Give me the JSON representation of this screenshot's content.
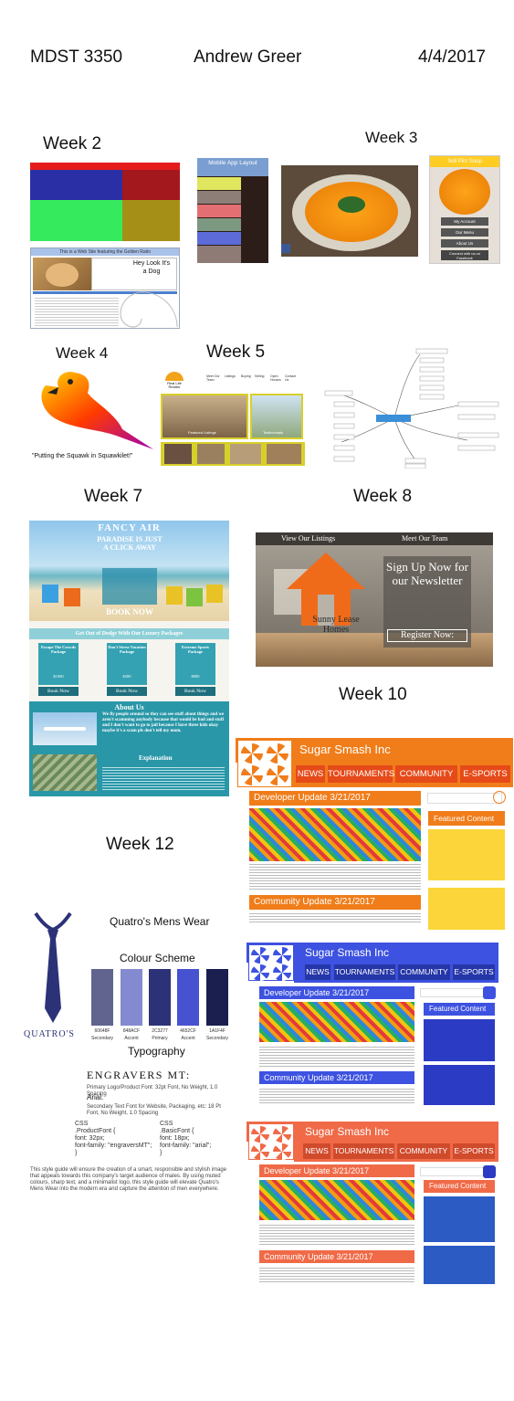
{
  "header": {
    "course": "MDST 3350",
    "author": "Andrew Greer",
    "date": "4/4/2017"
  },
  "weeks": {
    "w2": "Week 2",
    "w3": "Week 3",
    "w4": "Week 4",
    "w5": "Week 5",
    "w7": "Week 7",
    "w8": "Week 8",
    "w10": "Week 10",
    "w12": "Week 12"
  },
  "week2": {
    "golden_title": "This is a Web Site featuring the Golden Ratio",
    "dog_text": "Hey Look It's a Dog"
  },
  "week3": {
    "mobile_title": "Mobile App Layout",
    "soup_title": "Soll Pint Soup",
    "btn1": "My Account",
    "btn2": "Our Menu",
    "btn3": "About Us",
    "btn4": "Connect with us on Facebook"
  },
  "week4": {
    "slogan": "\"Putting the Squawk in Squawkilet!\""
  },
  "week5": {
    "brand": "Real Life Realtor",
    "nav": [
      "Meet Our Team",
      "Listings",
      "Buying",
      "Selling",
      "Open Houses",
      "Contact Us"
    ],
    "featured": "Featured Listings",
    "testimonials": "Testimonials"
  },
  "week7": {
    "title": "FANCY AIR",
    "hero": "PARADISE IS JUST A CLICK AWAY",
    "book": "BOOK NOW",
    "packages_heading": "Get Out of Dodge With Our Luxury Packages",
    "packages": [
      {
        "title": "Escape The Crowds Package",
        "price": "$1000"
      },
      {
        "title": "Don't Stress Vacation Package",
        "price": "$500"
      },
      {
        "title": "Extreme Sports Package",
        "price": "$900"
      }
    ],
    "pkg_btn": "Book Now",
    "about": "About Us",
    "about_text": "We fly people around so they can see stuff about things and we aren't scamming anybody because that would be bad and stuff and I don't want to go to jail because I have three kids okay maybe it's a scam pls don't tell my mom.",
    "explanation": "Explanation"
  },
  "week8": {
    "nav1": "View Our Listings",
    "nav2": "Meet Our Team",
    "logo": "Sunny Lease Homes",
    "signup": "Sign Up Now for our Newsletter",
    "register": "Register Now:"
  },
  "week10": {
    "site": "Sugar Smash Inc",
    "nav": [
      "NEWS",
      "TOURNAMENTS",
      "COMMUNITY",
      "E-SPORTS"
    ],
    "dev": "Developer Update 3/21/2017",
    "community": "Community Update 3/21/2017",
    "featured": "Featured Content"
  },
  "week12": {
    "brand": "Quatro's Mens Wear",
    "logo": "QUATRO'S",
    "scheme_title": "Colour Scheme",
    "swatches": [
      {
        "hex": "60648F",
        "role": "Secondary",
        "color": "#60648F"
      },
      {
        "hex": "848ACF",
        "role": "Accent",
        "color": "#848ACF"
      },
      {
        "hex": "2C3277",
        "role": "Primary",
        "color": "#2C3277"
      },
      {
        "hex": "4652CF",
        "role": "Accent",
        "color": "#4652CF"
      },
      {
        "hex": "1A1F4F",
        "role": "Secondary",
        "color": "#1A1F4F"
      }
    ],
    "typography": "Typography",
    "font1": "ENGRAVERS MT:",
    "font1_desc": "Primary Logo/Product Font: 32pt Font, No Weight, 1.0 Spacing",
    "font2": "Arial:",
    "font2_desc": "Secondary Text Font for Website, Packaging, etc: 18 Pt Font, No Weight, 1.0 Spacing",
    "css1": "CSS\n.ProductFont {\nfont: 32px;\nfont-family: \"engraversMT\";\n}",
    "css2": "CSS\n.BasicFont {\nfont: 18px;\nfont-family: \"arial\";\n}",
    "guide": "This style guide will ensure the creation of a smart, responsible and stylish image that appeals towards this company's target audience of males. By using muted colours, sharp text, and a minimalist logo, this style guide will elevate Quatro's Mens Wear into the modern era and capture the attention of men everywhere."
  }
}
